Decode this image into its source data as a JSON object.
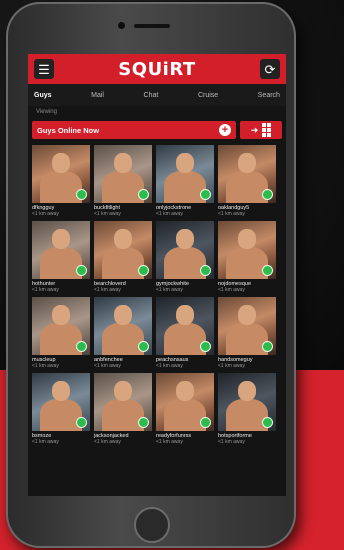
{
  "app": {
    "brand": "SQUiRT",
    "colors": {
      "accent": "#d21f2a",
      "online": "#2dbb4e",
      "background": "#141414"
    }
  },
  "tabs": [
    {
      "label": "Guys",
      "active": true
    },
    {
      "label": "Mail"
    },
    {
      "label": "Chat"
    },
    {
      "label": "Cruise"
    },
    {
      "label": "Search"
    }
  ],
  "viewing_label": "Viewing",
  "filter": {
    "selected": "Guys Online Now",
    "add_icon": "plus-icon",
    "toggle_icon": "grid-icon"
  },
  "profiles": [
    {
      "name": "dfkngguy",
      "distance": "<1 km away"
    },
    {
      "name": "buckfitlight",
      "distance": "<1 km away"
    },
    {
      "name": "onlyjockstrone",
      "distance": "<1 km away"
    },
    {
      "name": "oaklandguy5",
      "distance": "<1 km away"
    },
    {
      "name": "hothunter",
      "distance": "<1 km away"
    },
    {
      "name": "bearchloverd",
      "distance": "<1 km away"
    },
    {
      "name": "gymjockwhite",
      "distance": "<1 km away"
    },
    {
      "name": "nojdomesque",
      "distance": "<1 km away"
    },
    {
      "name": "muscleup",
      "distance": "<1 km away"
    },
    {
      "name": "anbfenchee",
      "distance": "<1 km away"
    },
    {
      "name": "peachsnsaus",
      "distance": "<1 km away"
    },
    {
      "name": "handsomeguy",
      "distance": "<1 km away"
    },
    {
      "name": "bsmoze",
      "distance": "<1 km away"
    },
    {
      "name": "jacksonjacked",
      "distance": "<1 km away"
    },
    {
      "name": "readyforfunrss",
      "distance": "<1 km away"
    },
    {
      "name": "hotsportforme",
      "distance": "<1 km away"
    }
  ]
}
